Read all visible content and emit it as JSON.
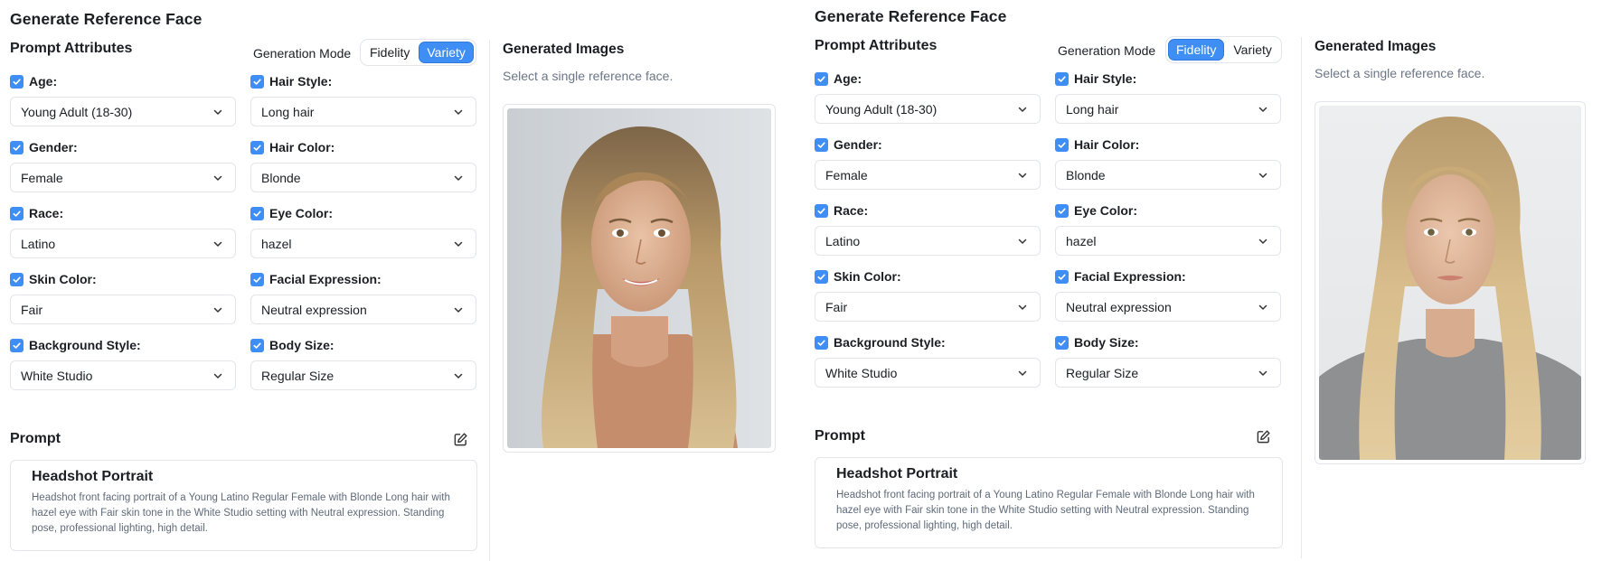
{
  "panels": [
    {
      "title": "Generate Reference Face",
      "prompt_attributes_title": "Prompt Attributes",
      "generation_mode": {
        "label": "Generation Mode",
        "options": [
          "Fidelity",
          "Variety"
        ],
        "selected": "Variety"
      },
      "attributes": [
        {
          "label": "Age:",
          "value": "Young Adult (18-30)",
          "checked": true
        },
        {
          "label": "Hair Style:",
          "value": "Long hair",
          "checked": true
        },
        {
          "label": "Gender:",
          "value": "Female",
          "checked": true
        },
        {
          "label": "Hair Color:",
          "value": "Blonde",
          "checked": true
        },
        {
          "label": "Race:",
          "value": "Latino",
          "checked": true
        },
        {
          "label": "Eye Color:",
          "value": "hazel",
          "checked": true
        },
        {
          "label": "Skin Color:",
          "value": "Fair",
          "checked": true
        },
        {
          "label": "Facial Expression:",
          "value": "Neutral expression",
          "checked": true
        },
        {
          "label": "Background Style:",
          "value": "White Studio",
          "checked": true
        },
        {
          "label": "Body Size:",
          "value": "Regular Size",
          "checked": true
        }
      ],
      "prompt": {
        "header": "Prompt",
        "card_title": "Headshot Portrait",
        "card_text": "Headshot front facing portrait of a Young Latino Regular Female with Blonde Long hair with hazel eye with Fair skin tone in the White Studio setting with Neutral expression. Standing pose, professional lighting, high detail."
      },
      "generated": {
        "title": "Generated Images",
        "subtitle": "Select a single reference face.",
        "image": "smiling-blonde-woman-portrait"
      }
    },
    {
      "title": "Generate Reference Face",
      "prompt_attributes_title": "Prompt Attributes",
      "generation_mode": {
        "label": "Generation Mode",
        "options": [
          "Fidelity",
          "Variety"
        ],
        "selected": "Fidelity"
      },
      "attributes": [
        {
          "label": "Age:",
          "value": "Young Adult (18-30)",
          "checked": true
        },
        {
          "label": "Hair Style:",
          "value": "Long hair",
          "checked": true
        },
        {
          "label": "Gender:",
          "value": "Female",
          "checked": true
        },
        {
          "label": "Hair Color:",
          "value": "Blonde",
          "checked": true
        },
        {
          "label": "Race:",
          "value": "Latino",
          "checked": true
        },
        {
          "label": "Eye Color:",
          "value": "hazel",
          "checked": true
        },
        {
          "label": "Skin Color:",
          "value": "Fair",
          "checked": true
        },
        {
          "label": "Facial Expression:",
          "value": "Neutral expression",
          "checked": true
        },
        {
          "label": "Background Style:",
          "value": "White Studio",
          "checked": true
        },
        {
          "label": "Body Size:",
          "value": "Regular Size",
          "checked": true
        }
      ],
      "prompt": {
        "header": "Prompt",
        "card_title": "Headshot Portrait",
        "card_text": "Headshot front facing portrait of a Young Latino Regular Female with Blonde Long hair with hazel eye with Fair skin tone in the White Studio setting with Neutral expression. Standing pose, professional lighting, high detail."
      },
      "generated": {
        "title": "Generated Images",
        "subtitle": "Select a single reference face.",
        "image": "neutral-blonde-woman-portrait"
      }
    }
  ],
  "colors": {
    "accent": "#3f8ef5",
    "border": "#e2e5e9",
    "muted_text": "#6b7686"
  }
}
